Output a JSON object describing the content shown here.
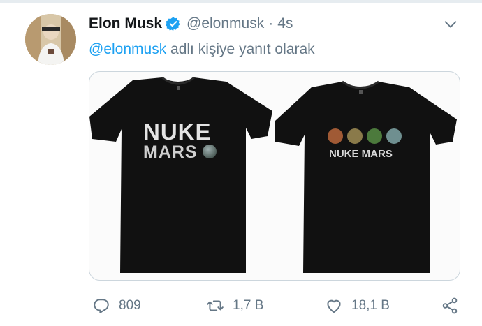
{
  "tweet": {
    "author_name": "Elon Musk",
    "handle": "@elonmusk",
    "separator": "·",
    "time": "4s",
    "reply_mention": "@elonmusk",
    "reply_suffix": " adlı kişiye yanıt olarak"
  },
  "media": {
    "shirt_left": {
      "line1": "NUKE",
      "line2": "MARS"
    },
    "shirt_right": {
      "text": "NUKE MARS"
    },
    "planet_colors": [
      "#a05a35",
      "#8a7a4a",
      "#4c7a3c",
      "#6f8f90"
    ]
  },
  "actions": {
    "reply_count": "809",
    "retweet_count": "1,7 B",
    "like_count": "18,1 B"
  },
  "icons": {
    "reply": "reply-icon",
    "retweet": "retweet-icon",
    "like": "like-icon",
    "share": "share-icon",
    "caret": "chevron-down-icon",
    "verified": "verified-badge-icon"
  },
  "colors": {
    "accent": "#1da1f2",
    "muted": "#657786",
    "shirt": "#111111"
  }
}
